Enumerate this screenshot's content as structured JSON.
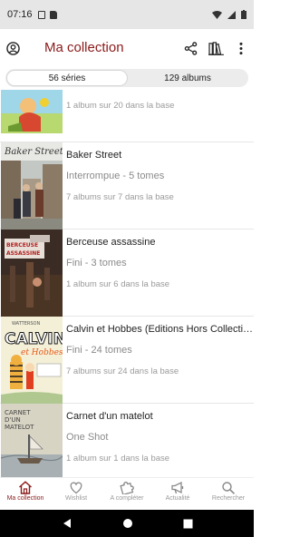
{
  "status": {
    "time": "07:16"
  },
  "header": {
    "title": "Ma collection"
  },
  "segments": [
    {
      "label": "56 séries",
      "active": true
    },
    {
      "label": "129 albums",
      "active": false
    }
  ],
  "items": [
    {
      "title": "",
      "status": "",
      "count": "1 album sur 20 dans la base"
    },
    {
      "title": "Baker Street",
      "status": "Interrompue - 5 tomes",
      "count": "7 albums sur 7 dans la base"
    },
    {
      "title": "Berceuse assassine",
      "status": "Fini - 3 tomes",
      "count": "1 album sur 6 dans la base"
    },
    {
      "title": "Calvin et Hobbes (Editions Hors Collecti…",
      "status": "Fini - 24 tomes",
      "count": "7 albums sur 24 dans la base"
    },
    {
      "title": "Carnet d'un matelot",
      "status": "One Shot",
      "count": "1 album sur 1 dans la base"
    }
  ],
  "nav": [
    {
      "label": "Ma collection",
      "icon": "home-icon",
      "active": true
    },
    {
      "label": "Wishlist",
      "icon": "heart-icon",
      "active": false
    },
    {
      "label": "A compléter",
      "icon": "puzzle-icon",
      "active": false
    },
    {
      "label": "Actualité",
      "icon": "megaphone-icon",
      "active": false
    },
    {
      "label": "Rechercher",
      "icon": "search-icon",
      "active": false
    }
  ],
  "colors": {
    "accent": "#8b1a1a",
    "statusbar": "#e6e6e6"
  }
}
